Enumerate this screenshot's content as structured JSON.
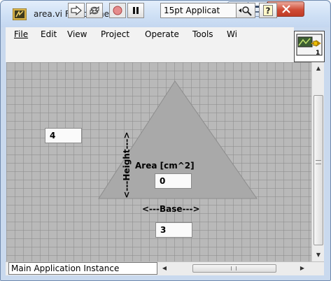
{
  "window": {
    "title": "area.vi Front Panel"
  },
  "menu": [
    {
      "label": "File"
    },
    {
      "label": "Edit"
    },
    {
      "label": "View"
    },
    {
      "label": "Project"
    },
    {
      "label": "Operate"
    },
    {
      "label": "Tools"
    },
    {
      "label": "Wi"
    }
  ],
  "toolbar": {
    "font_ring": "15pt Applicat",
    "connector_pane_label": "1"
  },
  "panel": {
    "height_label": "<---Height--->",
    "height_value": "4",
    "area_label": "Area [cm^2]",
    "area_value": "0",
    "base_label": "<---Base--->",
    "base_value": "3"
  },
  "statusbar": {
    "instance": "Main Application Instance"
  },
  "colors": {
    "panel_background": "#b9b9b9",
    "triangle_fill": "#a8a8a8",
    "close_button": "#c8442f"
  }
}
